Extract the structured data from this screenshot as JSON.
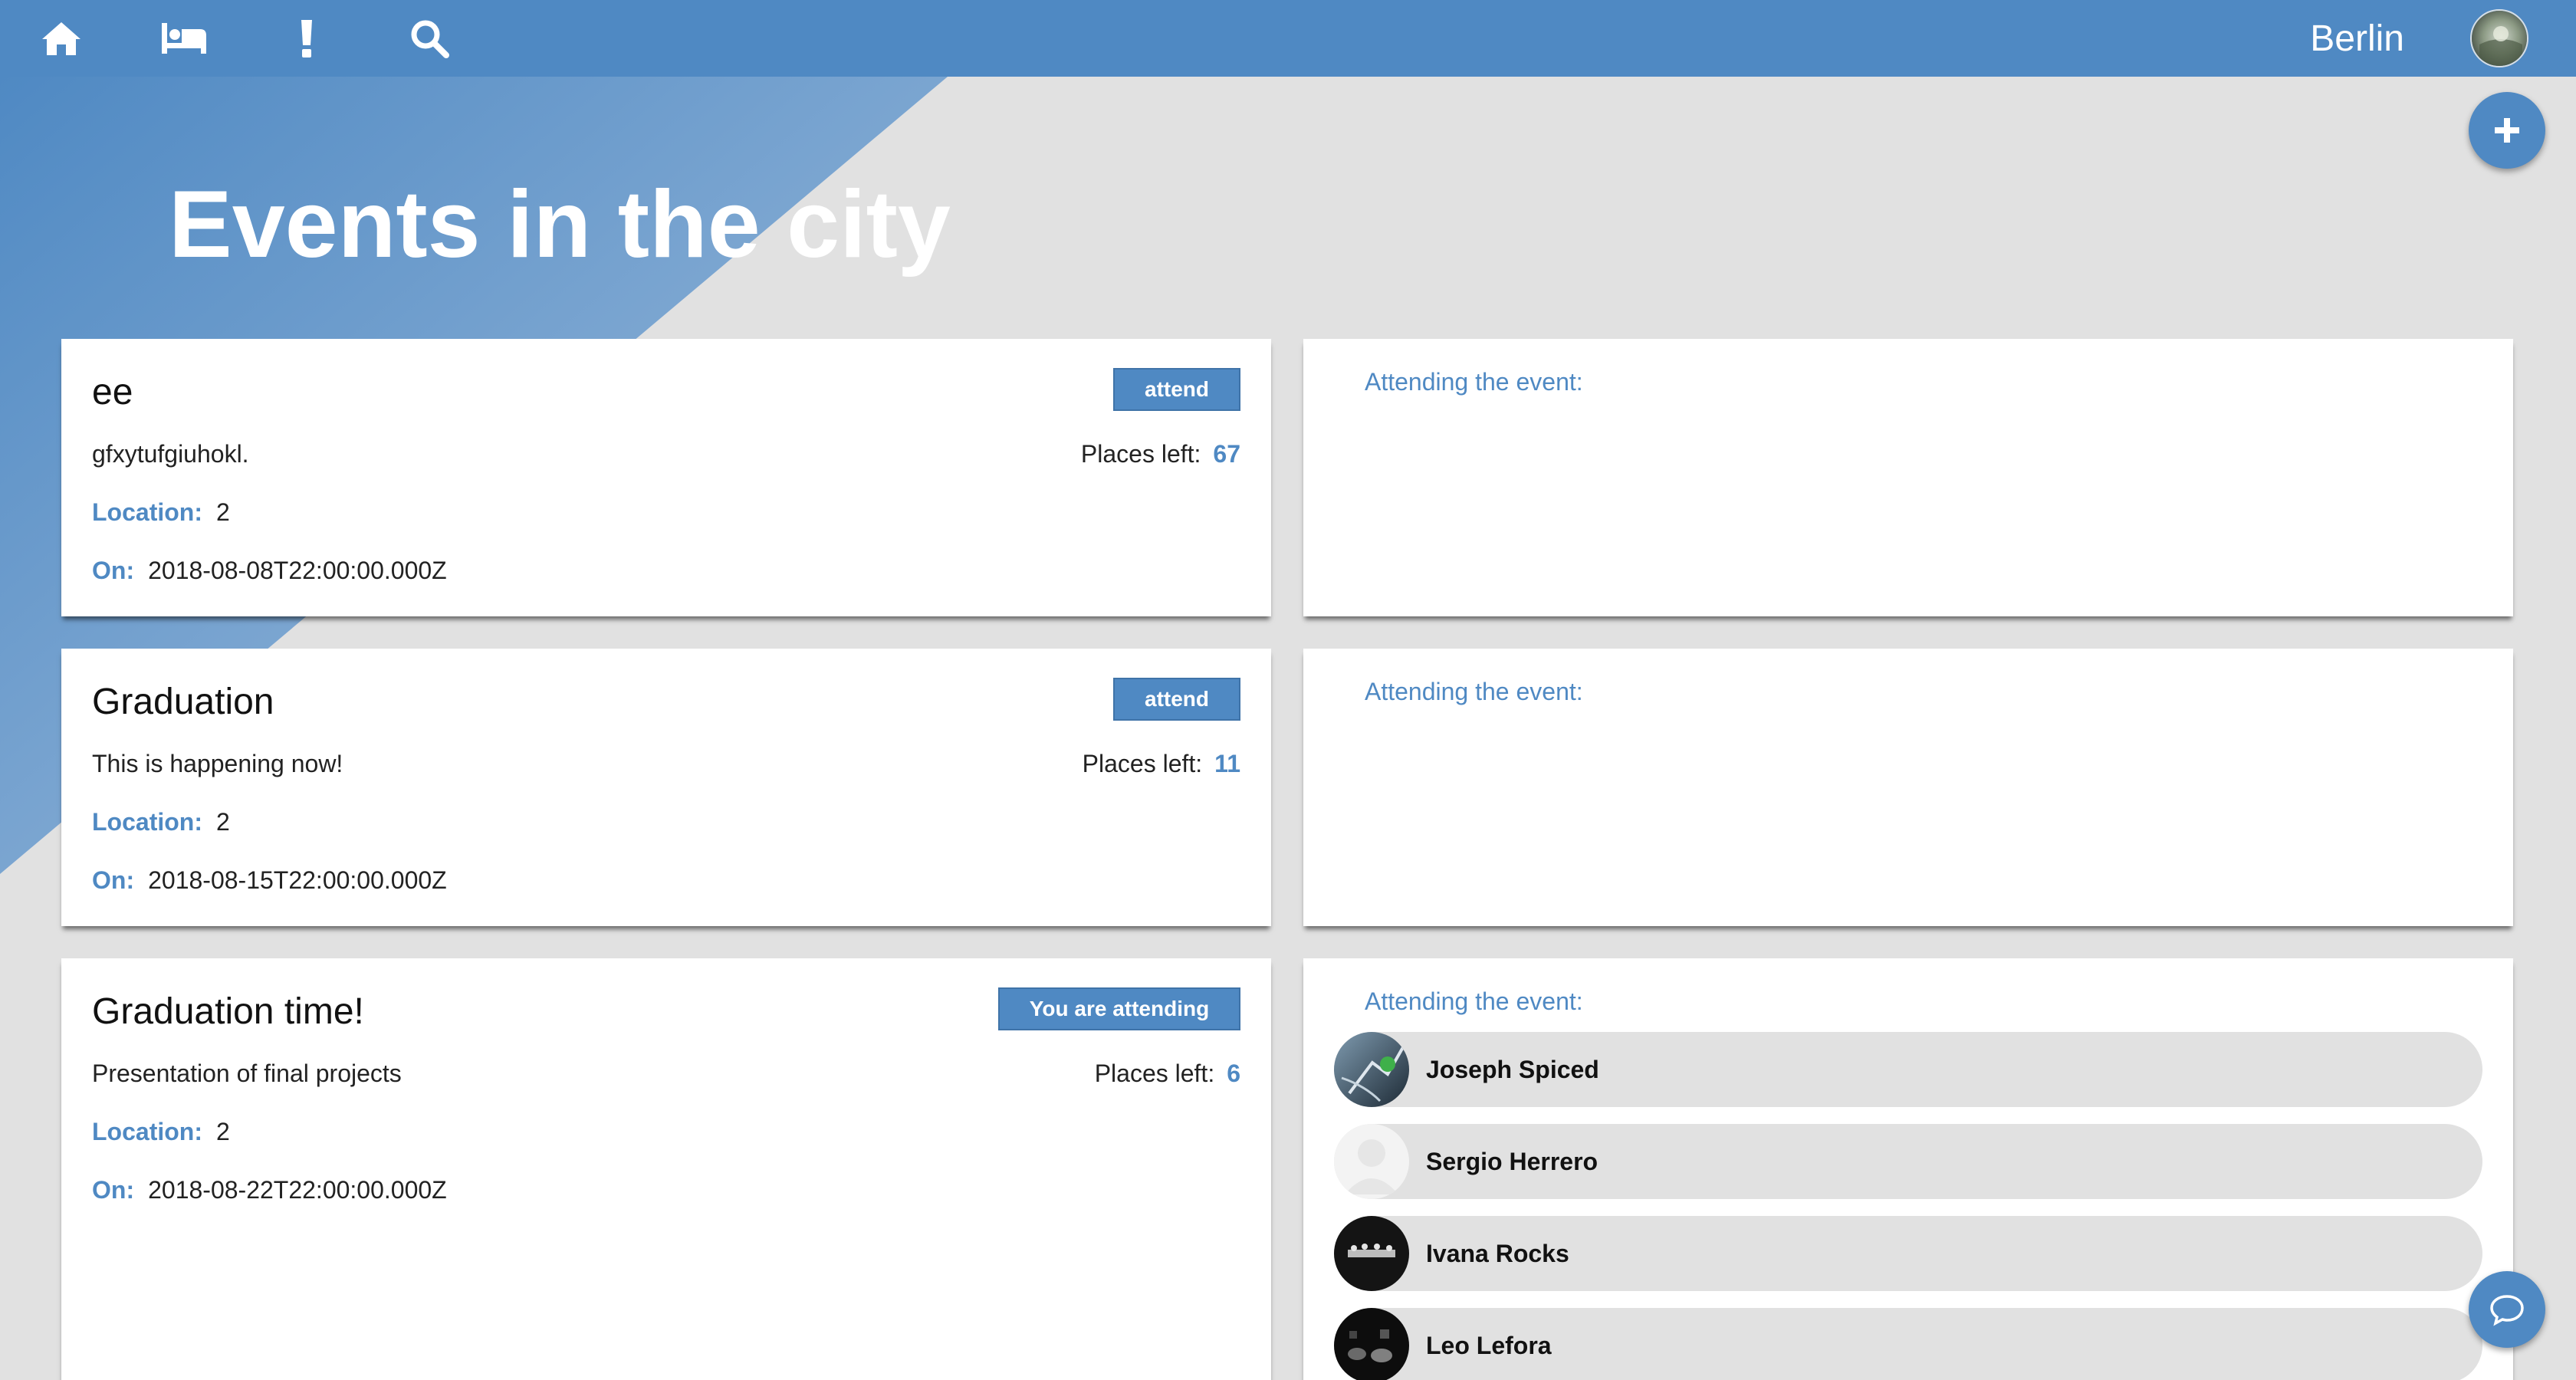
{
  "colors": {
    "brand": "#4f89c3",
    "background": "#e1e1e1",
    "card": "#ffffff"
  },
  "nav": {
    "items": [
      {
        "icon": "home-icon"
      },
      {
        "icon": "bed-icon"
      },
      {
        "icon": "exclamation-icon"
      },
      {
        "icon": "search-icon"
      }
    ],
    "city": "Berlin",
    "avatar_icon": "avatar"
  },
  "actions": {
    "add_icon": "plus-icon",
    "chat_icon": "chat-bubble-icon"
  },
  "page": {
    "title": "Events in the city"
  },
  "labels": {
    "places_left": "Places left:",
    "location": "Location:",
    "on": "On:",
    "attending_heading": "Attending the event:"
  },
  "events": [
    {
      "title": "ee",
      "button": "attend",
      "description": "gfxytufgiuhokl.",
      "places_left": "67",
      "location": "2",
      "date": "2018-08-08T22:00:00.000Z",
      "attendees": []
    },
    {
      "title": "Graduation",
      "button": "attend",
      "description": "This is happening now!",
      "places_left": "11",
      "location": "2",
      "date": "2018-08-15T22:00:00.000Z",
      "attendees": []
    },
    {
      "title": "Graduation time!",
      "button": "You are attending",
      "description": "Presentation of final projects",
      "places_left": "6",
      "location": "2",
      "date": "2018-08-22T22:00:00.000Z",
      "attendees": [
        {
          "name": "Joseph Spiced"
        },
        {
          "name": "Sergio Herrero"
        },
        {
          "name": "Ivana Rocks"
        },
        {
          "name": "Leo Lefora"
        }
      ]
    }
  ]
}
